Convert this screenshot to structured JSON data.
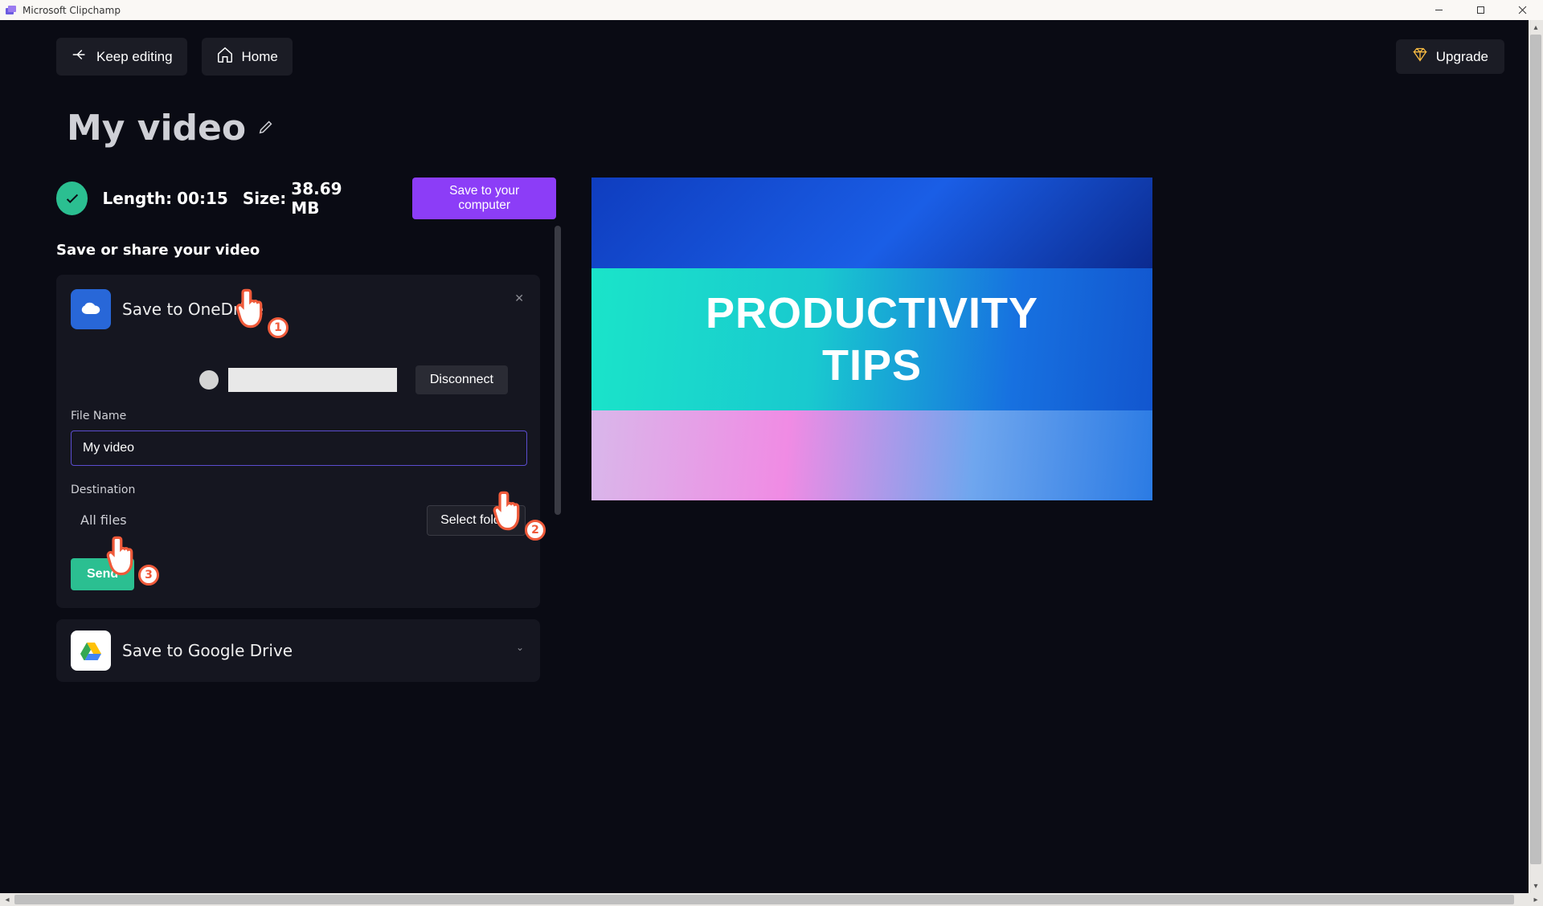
{
  "window": {
    "title": "Microsoft Clipchamp"
  },
  "top_nav": {
    "keep_editing": "Keep editing",
    "home": "Home",
    "upgrade": "Upgrade"
  },
  "video": {
    "title": "My video",
    "status": {
      "length_label": "Length:",
      "length_value": "00:15",
      "size_label": "Size:",
      "size_value": "38.69 MB"
    },
    "save_local": "Save to your computer",
    "share_heading": "Save or share your video"
  },
  "onedrive": {
    "title": "Save to OneDrive",
    "disconnect": "Disconnect",
    "filename_label": "File Name",
    "filename_value": "My video",
    "destination_label": "Destination",
    "destination_value": "All files",
    "select_folder": "Select folder",
    "send": "Send"
  },
  "googledrive": {
    "title": "Save to Google Drive"
  },
  "preview": {
    "line1": "PRODUCTIVITY",
    "line2": "TIPS"
  },
  "annotations": {
    "cursor1": "1",
    "cursor2": "2",
    "cursor3": "3"
  }
}
